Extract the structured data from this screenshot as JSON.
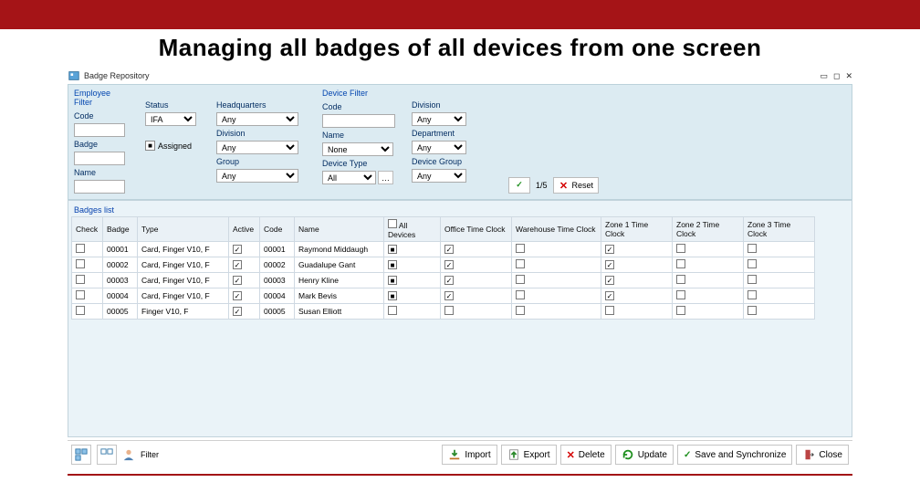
{
  "slide": {
    "title": "Managing all badges of all devices from one screen"
  },
  "window": {
    "title": "Badge Repository"
  },
  "filters": {
    "employee_section": "Employee Filter",
    "device_section": "Device Filter",
    "code_label": "Code",
    "status_label": "Status",
    "headquarters_label": "Headquarters",
    "division_label": "Division",
    "badge_label": "Badge",
    "assigned_label": "Assigned",
    "department_label": "Department",
    "name_label": "Name",
    "group_label": "Group",
    "device_type_label": "Device Type",
    "device_group_label": "Device Group",
    "code_dev_label": "Code",
    "division_dev_label": "Division",
    "status_value": "IFA",
    "any_value": "Any",
    "none_value": "None",
    "all_value": "All",
    "counter": "1/5",
    "reset_label": "Reset"
  },
  "grid": {
    "section_label": "Badges list",
    "headers": {
      "check": "Check",
      "badge": "Badge",
      "type": "Type",
      "active": "Active",
      "code": "Code",
      "name": "Name",
      "all_devices": "All Devices",
      "d1": "Office Time Clock",
      "d2": "Warehouse Time Clock",
      "d3": "Zone 1 Time Clock",
      "d4": "Zone 2 Time Clock",
      "d5": "Zone 3 Time Clock"
    },
    "rows": [
      {
        "badge": "00001",
        "type": "Card, Finger V10, F",
        "active": true,
        "code": "00001",
        "name": "Raymond Middaugh",
        "all": true,
        "d1": true,
        "d2": false,
        "d3": true,
        "d4": false,
        "d5": false
      },
      {
        "badge": "00002",
        "type": "Card, Finger V10, F",
        "active": true,
        "code": "00002",
        "name": "Guadalupe Gant",
        "all": true,
        "d1": true,
        "d2": false,
        "d3": true,
        "d4": false,
        "d5": false
      },
      {
        "badge": "00003",
        "type": "Card, Finger V10, F",
        "active": true,
        "code": "00003",
        "name": "Henry Kline",
        "all": true,
        "d1": true,
        "d2": false,
        "d3": true,
        "d4": false,
        "d5": false
      },
      {
        "badge": "00004",
        "type": "Card, Finger V10, F",
        "active": true,
        "code": "00004",
        "name": "Mark Bevis",
        "all": true,
        "d1": true,
        "d2": false,
        "d3": true,
        "d4": false,
        "d5": false
      },
      {
        "badge": "00005",
        "type": "Finger V10, F",
        "active": true,
        "code": "00005",
        "name": "Susan Elliott",
        "all": false,
        "d1": false,
        "d2": false,
        "d3": false,
        "d4": false,
        "d5": false
      }
    ]
  },
  "footer": {
    "filter_label": "Filter",
    "import": "Import",
    "export": "Export",
    "delete": "Delete",
    "update": "Update",
    "save_sync": "Save and Synchronize",
    "close": "Close"
  }
}
